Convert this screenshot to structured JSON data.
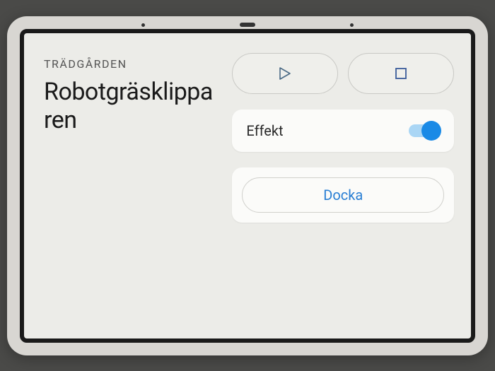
{
  "room": "TRÄDGÅRDEN",
  "device_name": "Robotgräsklipparen",
  "controls": {
    "play_icon": "play",
    "stop_icon": "stop"
  },
  "power": {
    "label": "Effekt",
    "on": true
  },
  "dock": {
    "label": "Docka"
  },
  "colors": {
    "accent": "#1a8ae6"
  }
}
